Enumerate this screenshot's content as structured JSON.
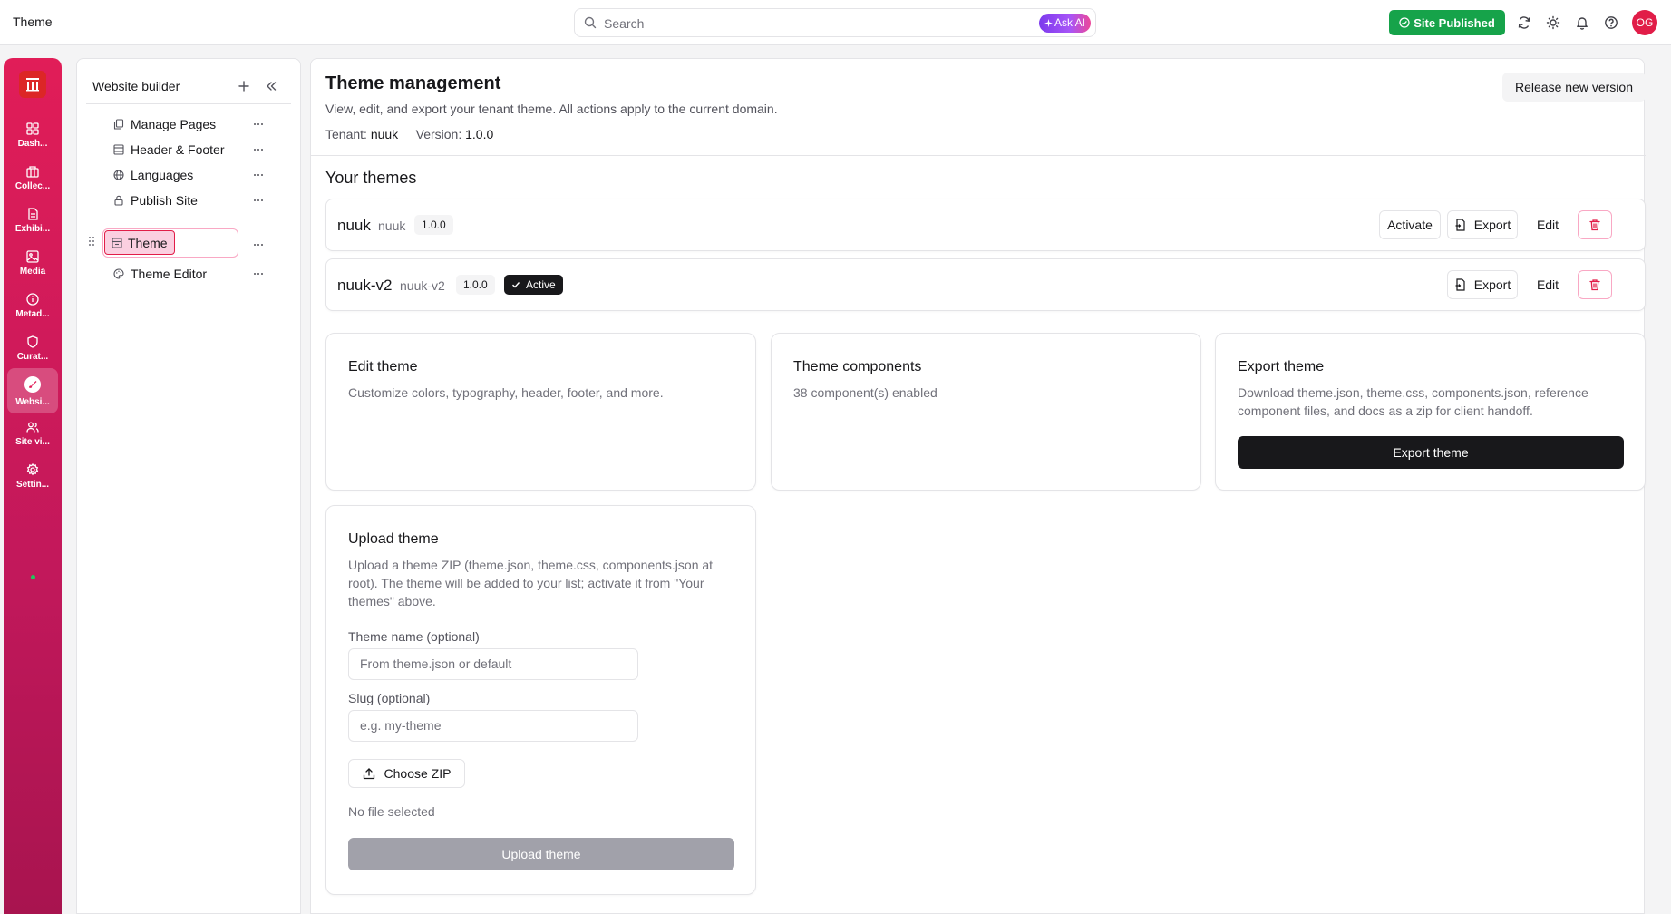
{
  "topbar": {
    "title": "Theme",
    "search_placeholder": "Search",
    "ask_ai_label": "Ask AI",
    "site_status_label": "Site Published",
    "avatar_initials": "OG",
    "status_color": "#16a34a"
  },
  "rail": {
    "items": [
      {
        "label": "Dash...",
        "icon": "grid-icon"
      },
      {
        "label": "Collec...",
        "icon": "collection-icon"
      },
      {
        "label": "Exhibi...",
        "icon": "document-icon"
      },
      {
        "label": "Media",
        "icon": "image-icon"
      },
      {
        "label": "Metad...",
        "icon": "info-icon"
      },
      {
        "label": "Curat...",
        "icon": "shield-icon"
      },
      {
        "label": "Websi...",
        "icon": "brush-icon",
        "active": true
      },
      {
        "label": "Site vi...",
        "icon": "users-icon"
      },
      {
        "label": "Settin...",
        "icon": "gear-icon"
      }
    ],
    "accent": "#e11d58"
  },
  "sidebar": {
    "title": "Website builder",
    "items": [
      {
        "label": "Manage Pages",
        "icon": "pages-icon"
      },
      {
        "label": "Header & Footer",
        "icon": "layout-icon"
      },
      {
        "label": "Languages",
        "icon": "globe-icon"
      },
      {
        "label": "Publish Site",
        "icon": "lock-icon"
      },
      {
        "label": "Theme",
        "icon": "theme-icon",
        "active": true
      },
      {
        "label": "Theme Editor",
        "icon": "palette-icon"
      }
    ]
  },
  "main": {
    "title": "Theme management",
    "subtitle": "View, edit, and export your tenant theme. All actions apply to the current domain.",
    "tenant_label": "Tenant:",
    "tenant_value": "nuuk",
    "version_label": "Version:",
    "version_value": "1.0.0",
    "release_button": "Release new version",
    "themes_heading": "Your themes",
    "themes": [
      {
        "name": "nuuk",
        "slug": "nuuk",
        "version": "1.0.0",
        "active": false,
        "activate_label": "Activate",
        "export_label": "Export",
        "edit_label": "Edit"
      },
      {
        "name": "nuuk-v2",
        "slug": "nuuk-v2",
        "version": "1.0.0",
        "active": true,
        "active_label": "Active",
        "export_label": "Export",
        "edit_label": "Edit"
      }
    ],
    "cards": {
      "edit": {
        "title": "Edit theme",
        "desc": "Customize colors, typography, header, footer, and more."
      },
      "components": {
        "title": "Theme components",
        "desc": "38 component(s) enabled"
      },
      "export": {
        "title": "Export theme",
        "desc_line1": "Download theme.json, theme.css, components.json, reference",
        "desc_line2": "component files, and docs as a zip for client handoff.",
        "button": "Export theme"
      }
    },
    "upload": {
      "title": "Upload theme",
      "desc_line1": "Upload a theme ZIP (theme.json, theme.css, components.json at",
      "desc_line2": "root). The theme will be added to your list; activate it from \"Your",
      "desc_line3": "themes\" above.",
      "name_label": "Theme name (optional)",
      "name_placeholder": "From theme.json or default",
      "slug_label": "Slug (optional)",
      "slug_placeholder": "e.g. my-theme",
      "choose_label": "Choose ZIP",
      "file_status": "No file selected",
      "upload_button": "Upload theme"
    }
  }
}
